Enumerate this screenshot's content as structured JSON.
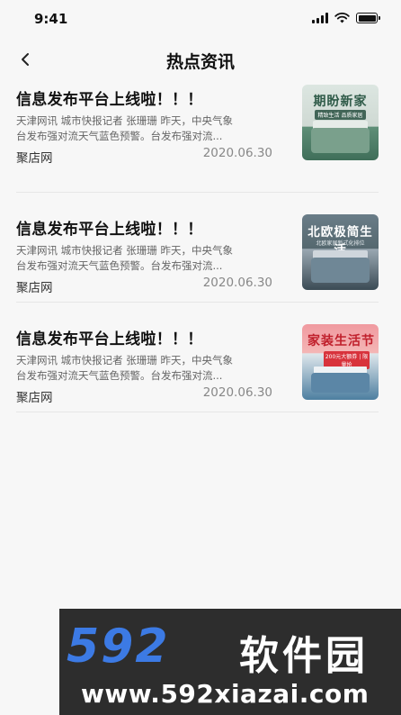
{
  "status_bar": {
    "time": "9:41",
    "signal_icon": "signal-icon",
    "wifi_icon": "wifi-icon",
    "battery_icon": "battery-icon"
  },
  "nav": {
    "back_icon": "chevron-left-icon",
    "title": "热点资讯"
  },
  "news": [
    {
      "title": "信息发布平台上线啦！！！",
      "summary": "天津网讯 城市快报记者 张珊珊 昨天，中央气象台发布强对流天气蓝色预警。台发布强对流...",
      "source": "聚店网",
      "date": "2020.06.30",
      "thumb_headline": "期盼新家",
      "thumb_sub": "精致生活 品质家居"
    },
    {
      "title": "信息发布平台上线啦！！！",
      "summary": "天津网讯 城市快报记者 张珊珊 昨天，中央气象台发布强对流天气蓝色预警。台发布强对流...",
      "source": "聚店网",
      "date": "2020.06.30",
      "thumb_headline": "北欧极简生活",
      "thumb_sub": "北欧家居新式化排位"
    },
    {
      "title": "信息发布平台上线啦！！！",
      "summary": "天津网讯 城市快报记者 张珊珊 昨天，中央气象台发布强对流天气蓝色预警。台发布强对流...",
      "source": "聚店网",
      "date": "2020.06.30",
      "thumb_headline": "家装生活节",
      "thumb_sub": "200元大额券 | 限量抢"
    }
  ],
  "watermark": {
    "logo": "592",
    "name": "软件园",
    "url": "www.592xiazai.com"
  },
  "colors": {
    "background": "#f7f7f7",
    "title_text": "#111111",
    "summary_text": "#666666",
    "date_text": "#888888",
    "watermark_blue": "#3c7ae4"
  }
}
